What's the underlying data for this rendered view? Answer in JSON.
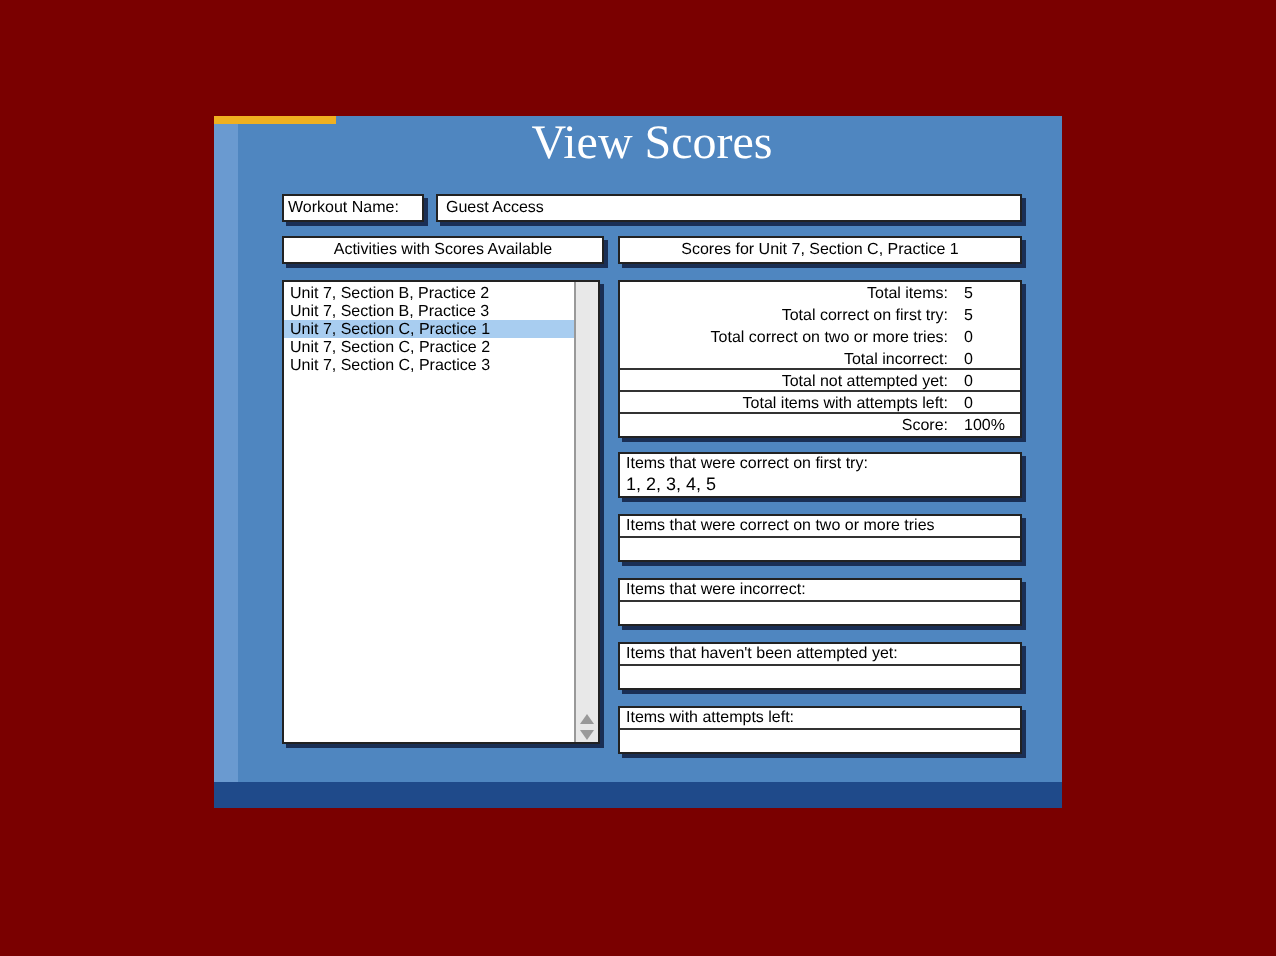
{
  "title": "View Scores",
  "workout": {
    "label": "Workout Name:",
    "value": "Guest Access"
  },
  "activities_header": "Activities with Scores Available",
  "scores_header": "Scores for Unit 7, Section C, Practice 1",
  "activities": [
    {
      "label": "Unit 7, Section B, Practice 2",
      "selected": false
    },
    {
      "label": "Unit 7, Section B, Practice 3",
      "selected": false
    },
    {
      "label": "Unit 7, Section C, Practice 1",
      "selected": true
    },
    {
      "label": "Unit 7, Section C, Practice 2",
      "selected": false
    },
    {
      "label": "Unit 7, Section C, Practice 3",
      "selected": false
    }
  ],
  "stats": [
    {
      "label": "Total items:",
      "value": "5"
    },
    {
      "label": "Total correct on first try:",
      "value": "5"
    },
    {
      "label": "Total correct on two or more tries:",
      "value": "0"
    },
    {
      "label": "Total incorrect:",
      "value": "0"
    },
    {
      "label": "Total not attempted yet:",
      "value": "0"
    },
    {
      "label": "Total items with attempts left:",
      "value": "0"
    },
    {
      "label": "Score:",
      "value": "100%"
    }
  ],
  "item_boxes": [
    {
      "label": "Items that were correct on first try:",
      "value": "1, 2, 3, 4, 5"
    },
    {
      "label": "Items that were correct on two or more tries"
    },
    {
      "label": "Items that were incorrect:"
    },
    {
      "label": "Items that haven't been attempted yet:"
    },
    {
      "label": "Items with attempts left:"
    }
  ]
}
